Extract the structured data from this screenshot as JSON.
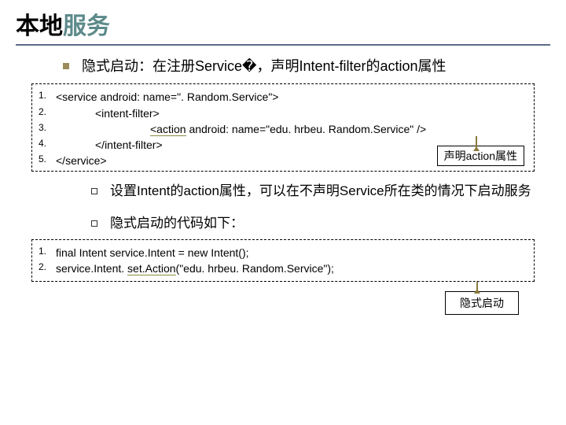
{
  "title_black": "本地",
  "title_teal": "服务",
  "main_bullet": "隐式启动：在注册Service�，声明Intent-filter的action属性",
  "code1": {
    "lines": [
      {
        "n": "1.",
        "t": "<service android: name=\". Random.Service\">"
      },
      {
        "n": "2.",
        "t": "<intent-filter>"
      },
      {
        "n": "3.",
        "t": "<action android: name=\"edu. hrbeu. Random.Service\" />",
        "action": true
      },
      {
        "n": "4.",
        "t": "</intent-filter>"
      },
      {
        "n": "5.",
        "t": "</service>"
      }
    ]
  },
  "callout1": "声明action属性",
  "sub1": "设置Intent的action属性，可以在不声明Service所在类的情况下启动服务",
  "sub2": "隐式启动的代码如下：",
  "code2": {
    "lines": [
      {
        "n": "1.",
        "t": "final Intent service.Intent = new Intent();"
      },
      {
        "n": "2.",
        "t": "service.Intent. set.Action(\"edu. hrbeu. Random.Service\");",
        "ul": true
      }
    ]
  },
  "callout2": "隐式启动"
}
